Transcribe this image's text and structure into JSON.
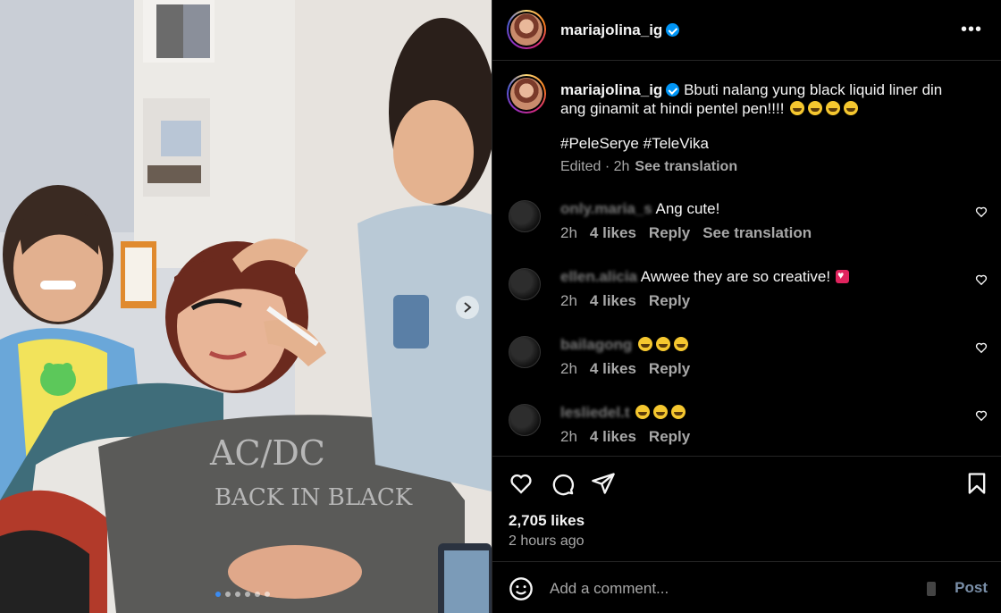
{
  "header": {
    "username": "mariajolina_ig",
    "verified": true,
    "more_icon": "more-horizontal-icon"
  },
  "caption": {
    "username": "mariajolina_ig",
    "text": "Bbuti nalang yung black liquid liner din ang ginamit at hindi pentel pen!!!!",
    "emoji": [
      "rolling-laughing-emoji",
      "rolling-laughing-emoji",
      "rolling-laughing-emoji",
      "rolling-laughing-emoji"
    ],
    "hashtags": "#PeleSerye #TeleVika",
    "edited": "Edited · 2h",
    "see_translation": "See translation"
  },
  "comments": [
    {
      "username": "only.maria_s",
      "text": "Ang cute!",
      "time": "2h",
      "likes": "4 likes",
      "reply": "Reply",
      "see_translation": "See translation"
    },
    {
      "username": "ellen.alicia",
      "text": "Awwee they are so creative!",
      "emoji": "heart-emoji",
      "time": "2h",
      "likes": "4 likes",
      "reply": "Reply"
    },
    {
      "username": "bailagong",
      "text": "",
      "emoji": "grinning-emoji x3",
      "time": "2h",
      "likes": "4 likes",
      "reply": "Reply"
    },
    {
      "username": "lesliedel.t",
      "text": "",
      "emoji": "grinning-emoji x3",
      "time": "2h",
      "likes": "4 likes",
      "reply": "Reply"
    }
  ],
  "actions": {
    "like_icon": "heart-outline-icon",
    "comment_icon": "comment-bubble-icon",
    "share_icon": "paper-plane-icon",
    "save_icon": "bookmark-icon"
  },
  "likes": "2,705 likes",
  "posted": "2 hours ago",
  "add_comment": {
    "placeholder": "Add a comment...",
    "post_label": "Post"
  },
  "carousel": {
    "count": 6,
    "active": 1
  },
  "colors": {
    "background": "#000000",
    "accent": "#0095f6",
    "muted": "#a8a8a8",
    "divider": "#262626"
  }
}
